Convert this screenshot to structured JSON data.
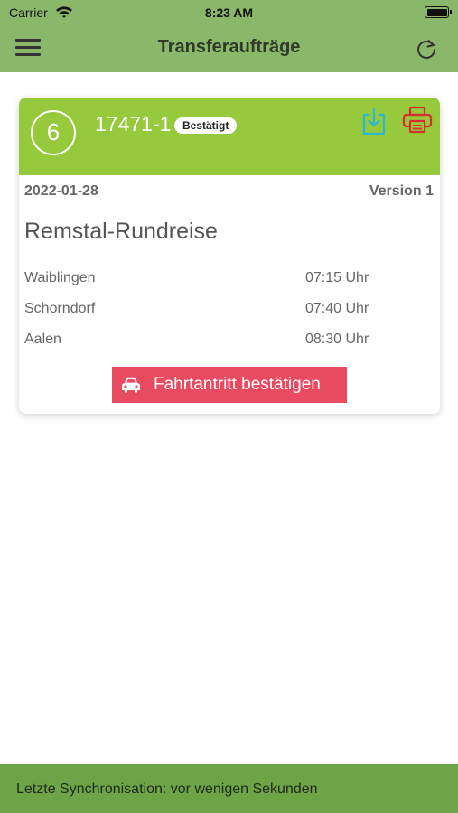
{
  "status_bar": {
    "carrier": "Carrier",
    "time": "8:23 AM"
  },
  "header": {
    "title": "Transferaufträge"
  },
  "order": {
    "index": "6",
    "number": "17471-1",
    "status": "Bestätigt",
    "date": "2022-01-28",
    "version": "Version 1",
    "tour_name": "Remstal-Rundreise",
    "stops": [
      {
        "place": "Waiblingen",
        "time": "07:15 Uhr"
      },
      {
        "place": "Schorndorf",
        "time": "07:40 Uhr"
      },
      {
        "place": "Aalen",
        "time": "08:30 Uhr"
      }
    ],
    "confirm_label": "Fahrtantritt bestätigen"
  },
  "footer": {
    "sync_text": "Letzte Synchronisation: vor wenigen Sekunden"
  },
  "colors": {
    "header_bg": "#8ab76a",
    "card_header_bg": "#97c93d",
    "confirm_bg": "#e84a5f",
    "footer_bg": "#6ea448",
    "download_icon": "#2bb7d6",
    "print_icon": "#d62d2d"
  }
}
